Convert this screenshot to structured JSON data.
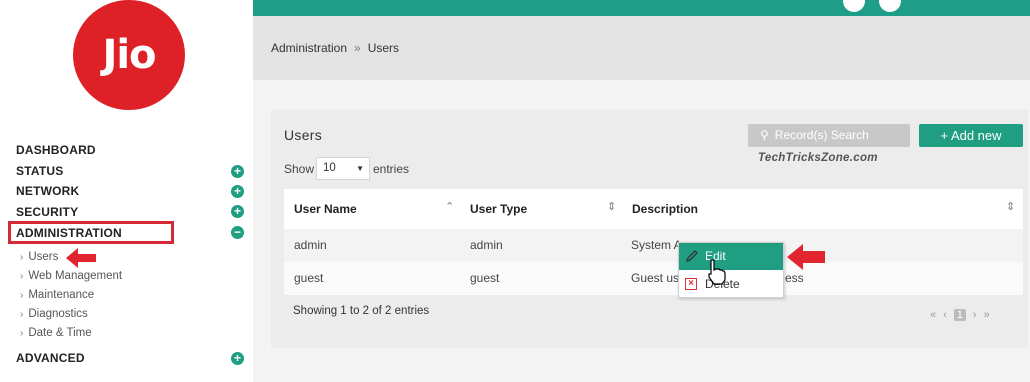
{
  "brand": {
    "logo_text": "Jio",
    "logo_color": "#dd2127"
  },
  "colors": {
    "accent": "#1f9e82",
    "highlight": "#d42a36"
  },
  "sidebar": {
    "items": [
      {
        "label": "DASHBOARD",
        "expandable": false
      },
      {
        "label": "STATUS",
        "expandable": true,
        "icon": "plus-icon"
      },
      {
        "label": "NETWORK",
        "expandable": true,
        "icon": "plus-icon"
      },
      {
        "label": "SECURITY",
        "expandable": true,
        "icon": "plus-icon"
      },
      {
        "label": "ADMINISTRATION",
        "expandable": true,
        "icon": "minus-icon"
      },
      {
        "label": "ADVANCED",
        "expandable": true,
        "icon": "plus-icon"
      }
    ],
    "sub_items": [
      {
        "label": "Users"
      },
      {
        "label": "Web Management"
      },
      {
        "label": "Maintenance"
      },
      {
        "label": "Diagnostics"
      },
      {
        "label": "Date & Time"
      }
    ]
  },
  "breadcrumb": {
    "parent": "Administration",
    "separator": "»",
    "current": "Users"
  },
  "panel": {
    "title": "Users",
    "search_placeholder": "Record(s) Search",
    "add_label": "+ Add new",
    "watermark": "TechTricksZone.com",
    "show_label": "Show",
    "page_size": "10",
    "entries_label": "entries"
  },
  "table": {
    "columns": [
      "User Name",
      "User Type",
      "Description"
    ],
    "rows": [
      {
        "name": "admin",
        "type": "admin",
        "description": "System Administrator"
      },
      {
        "name": "guest",
        "type": "guest",
        "description": "Guest user for web access"
      }
    ],
    "row1_desc_visible": "System A",
    "row2_desc_visible": "Guest us",
    "row2_desc_tail": "ess"
  },
  "footer": {
    "showing": "Showing 1 to 2 of 2 entries",
    "pager": {
      "first": "«",
      "prev": "‹",
      "current": "1",
      "next": "›",
      "last": "»"
    }
  },
  "context_menu": {
    "edit": "Edit",
    "delete": "Delete"
  }
}
